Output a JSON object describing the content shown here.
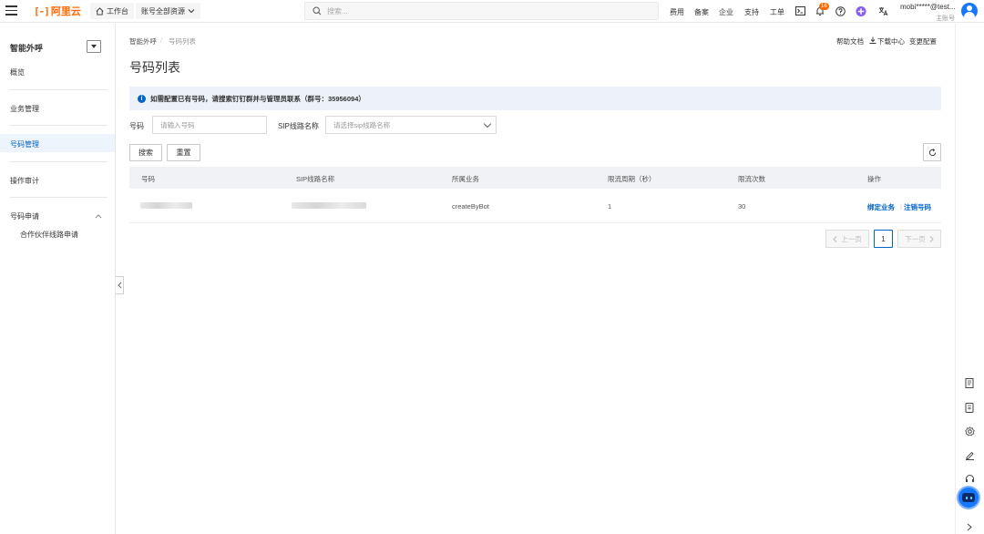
{
  "topbar": {
    "logo_mark": "[-]",
    "logo_text": "阿里云",
    "workbench": "工作台",
    "account_scope": "账号全部资源",
    "search_placeholder": "搜索...",
    "links": [
      "费用",
      "备案",
      "企业",
      "支持",
      "工单"
    ],
    "notification_count": "16",
    "user_name": "mobi*****@test...",
    "user_role": "主账号",
    "accent_color": "#ff6a00"
  },
  "sidebar": {
    "title": "智能外呼",
    "items": [
      {
        "label": "概览"
      },
      {
        "label": "业务管理"
      },
      {
        "label": "号码管理"
      },
      {
        "label": "操作审计"
      },
      {
        "label": "号码申请"
      }
    ],
    "sub_items": [
      {
        "label": "合作伙伴线路申请"
      }
    ],
    "active_color": "#0064c8"
  },
  "breadcrumb": [
    "智能外呼",
    "号码列表"
  ],
  "breadcrumb_sep": "/",
  "top_actions": [
    "帮助文档",
    "下载中心",
    "变更配置"
  ],
  "page_title": "号码列表",
  "notice": "如需配置已有号码，请搜索钉钉群并与管理员联系（群号：35956094）",
  "filters": {
    "number_label": "号码",
    "number_placeholder": "请输入号码",
    "sip_label": "SIP线路名称",
    "sip_placeholder": "请选择sip线路名称"
  },
  "buttons": {
    "search": "搜索",
    "reset": "重置"
  },
  "table": {
    "headers": [
      "号码",
      "SIP线路名称",
      "所属业务",
      "限流周期（秒）",
      "限流次数",
      "操作"
    ],
    "rows": [
      {
        "business": "createByBot",
        "period": "1",
        "count": "30",
        "actions": [
          "绑定业务",
          "注销号码"
        ]
      }
    ]
  },
  "pager": {
    "prev": "上一页",
    "current": "1",
    "next": "下一页"
  }
}
